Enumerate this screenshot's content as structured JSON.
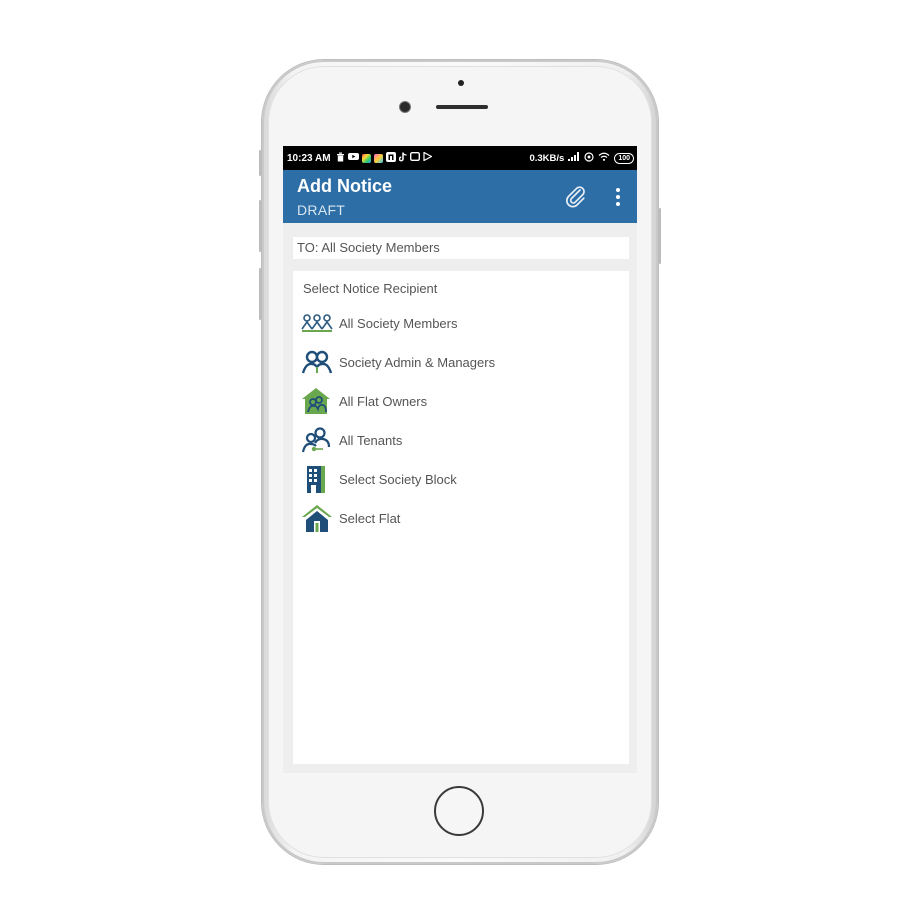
{
  "status_bar": {
    "time": "10:23 AM",
    "speed": "0.3KB/s",
    "battery": "100"
  },
  "app_bar": {
    "title": "Add Notice",
    "subtitle": "DRAFT",
    "background_color": "#2d6ea6"
  },
  "to_field": {
    "text": "TO: All Society Members"
  },
  "recipient_card": {
    "heading": "Select Notice Recipient",
    "items": [
      {
        "label": "All Society Members",
        "icon": "group-members-icon"
      },
      {
        "label": "Society Admin & Managers",
        "icon": "admin-managers-icon"
      },
      {
        "label": "All Flat Owners",
        "icon": "flat-owners-icon"
      },
      {
        "label": "All Tenants",
        "icon": "tenants-icon"
      },
      {
        "label": "Select Society Block",
        "icon": "building-block-icon"
      },
      {
        "label": "Select Flat",
        "icon": "house-icon"
      }
    ]
  },
  "colors": {
    "navy": "#1f4e79",
    "green": "#6aa84f"
  }
}
